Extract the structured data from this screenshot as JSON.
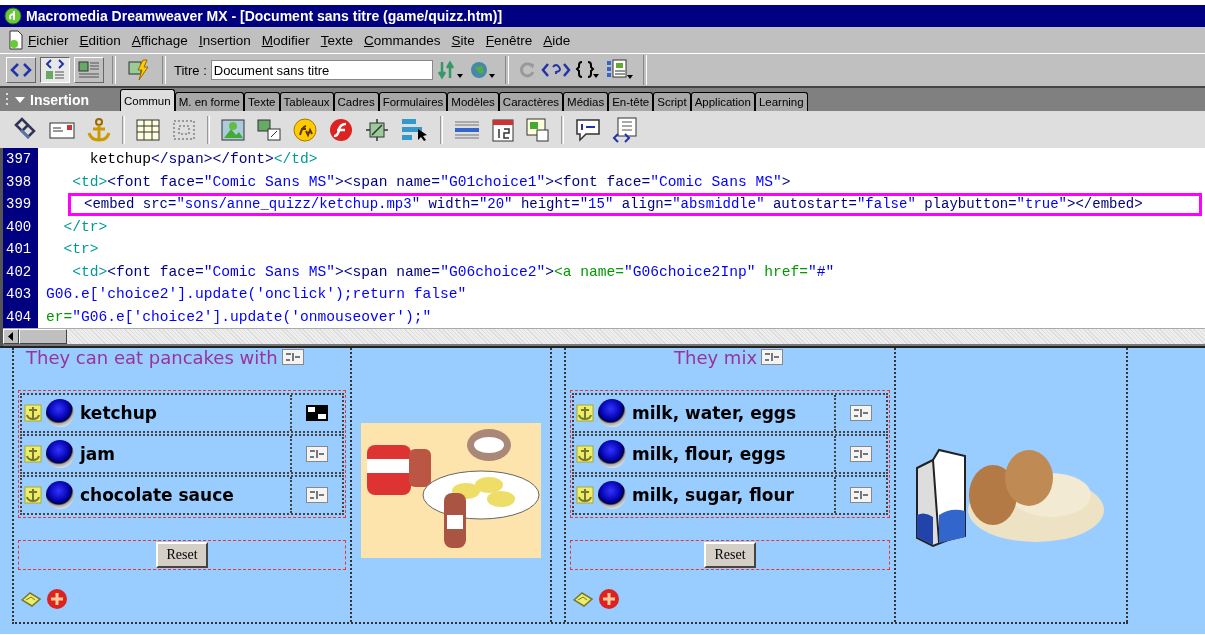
{
  "window": {
    "title": "Macromedia Dreamweaver MX - [Document sans titre (game/quizz.htm)]"
  },
  "menu": [
    "Fichier",
    "Edition",
    "Affichage",
    "Insertion",
    "Modifier",
    "Texte",
    "Commandes",
    "Site",
    "Fenêtre",
    "Aide"
  ],
  "toolbar": {
    "view_buttons": [
      {
        "selected": false
      },
      {
        "selected": true
      },
      {
        "selected": false
      }
    ],
    "title_label": "Titre :",
    "title_value": "Document sans titre"
  },
  "insert_bar": {
    "title": "Insertion",
    "tabs": [
      {
        "label": "Commun",
        "selected": true
      },
      {
        "label": "M. en forme",
        "selected": false
      },
      {
        "label": "Texte",
        "selected": false
      },
      {
        "label": "Tableaux",
        "selected": false
      },
      {
        "label": "Cadres",
        "selected": false
      },
      {
        "label": "Formulaires",
        "selected": false
      },
      {
        "label": "Modèles",
        "selected": false
      },
      {
        "label": "Caractères",
        "selected": false
      },
      {
        "label": "Médias",
        "selected": false
      },
      {
        "label": "En-tête",
        "selected": false
      },
      {
        "label": "Script",
        "selected": false
      },
      {
        "label": "Application",
        "selected": false
      },
      {
        "label": "Learning",
        "selected": false
      }
    ]
  },
  "code": {
    "lines": [
      {
        "number": "397",
        "highlighted": false,
        "tokens": [
          {
            "text": "     ketchup",
            "kind": "text"
          },
          {
            "text": "</span></font>",
            "kind": "tag"
          },
          {
            "text": "</td>",
            "kind": "struct"
          }
        ]
      },
      {
        "number": "398",
        "highlighted": false,
        "tokens": [
          {
            "text": "   <td>",
            "kind": "struct"
          },
          {
            "text": "<font face=",
            "kind": "tag"
          },
          {
            "text": "\"Comic Sans MS\"",
            "kind": "value"
          },
          {
            "text": "><span name=",
            "kind": "tag"
          },
          {
            "text": "\"G01choice1\"",
            "kind": "value"
          },
          {
            "text": "><font face=",
            "kind": "tag"
          },
          {
            "text": "\"Comic Sans MS\"",
            "kind": "value"
          },
          {
            "text": ">",
            "kind": "tag"
          }
        ]
      },
      {
        "number": "399",
        "highlighted": true,
        "tokens": [
          {
            "text": "<embed src=",
            "kind": "tag"
          },
          {
            "text": "\"sons/anne_quizz/ketchup.mp3\"",
            "kind": "value"
          },
          {
            "text": " width=",
            "kind": "tag"
          },
          {
            "text": "\"20\"",
            "kind": "value"
          },
          {
            "text": " height=",
            "kind": "tag"
          },
          {
            "text": "\"15\"",
            "kind": "value"
          },
          {
            "text": " align=",
            "kind": "tag"
          },
          {
            "text": "\"absmiddle\"",
            "kind": "value"
          },
          {
            "text": " autostart=",
            "kind": "tag"
          },
          {
            "text": "\"false\"",
            "kind": "value"
          },
          {
            "text": " playbutton=",
            "kind": "tag"
          },
          {
            "text": "\"true\"",
            "kind": "value"
          },
          {
            "text": "></embed>",
            "kind": "tag"
          }
        ]
      },
      {
        "number": "400",
        "highlighted": false,
        "tokens": [
          {
            "text": "  </tr>",
            "kind": "struct"
          }
        ]
      },
      {
        "number": "401",
        "highlighted": false,
        "tokens": [
          {
            "text": "  <tr>",
            "kind": "struct"
          }
        ]
      },
      {
        "number": "402",
        "highlighted": false,
        "tokens": [
          {
            "text": "   <td>",
            "kind": "struct"
          },
          {
            "text": "<font face=",
            "kind": "tag"
          },
          {
            "text": "\"Comic Sans MS\"",
            "kind": "value"
          },
          {
            "text": "><span name=",
            "kind": "tag"
          },
          {
            "text": "\"G06choice2\"",
            "kind": "value"
          },
          {
            "text": ">",
            "kind": "tag"
          },
          {
            "text": "<a name=",
            "kind": "link"
          },
          {
            "text": "\"G06choice2Inp\"",
            "kind": "value"
          },
          {
            "text": " href=",
            "kind": "link"
          },
          {
            "text": "\"#\"",
            "kind": "value"
          }
        ]
      },
      {
        "number": "403",
        "highlighted": false,
        "tokens": [
          {
            "text": "G06.e['choice2'].update('onclick');return false\"",
            "kind": "value"
          }
        ]
      },
      {
        "number": "404",
        "highlighted": false,
        "tokens": [
          {
            "text": "er=",
            "kind": "link"
          },
          {
            "text": "\"G06.e['choice2'].update('onmouseover');\"",
            "kind": "value"
          }
        ]
      }
    ]
  },
  "design": {
    "quizzes": [
      {
        "question": "They can eat pancakes with",
        "options": [
          {
            "label": "ketchup",
            "checked": false,
            "selected": true
          },
          {
            "label": "jam",
            "checked": false,
            "selected": false
          },
          {
            "label": "chocolate sauce",
            "checked": false,
            "selected": false
          }
        ],
        "reset": "Reset"
      },
      {
        "question": "They mix",
        "options": [
          {
            "label": "milk, water, eggs",
            "checked": false,
            "selected": false
          },
          {
            "label": "milk, flour, eggs",
            "checked": false,
            "selected": false
          },
          {
            "label": "milk, sugar, flour",
            "checked": false,
            "selected": false
          }
        ],
        "reset": "Reset"
      }
    ]
  }
}
